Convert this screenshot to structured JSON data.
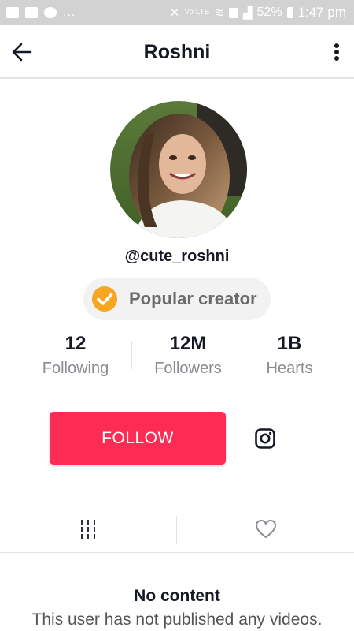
{
  "status_bar": {
    "battery": "52%",
    "time": "1:47 pm",
    "network": "Vo LTE",
    "dots": "...",
    "icons": [
      "image-icon",
      "folder-icon",
      "chat-icon",
      "mute-icon",
      "wifi-icon",
      "sim-icon",
      "signal-icon",
      "battery-icon"
    ]
  },
  "header": {
    "title": "Roshni",
    "back_icon": "arrow-left-icon",
    "more_icon": "vertical-dots-icon"
  },
  "profile": {
    "username": "@cute_roshni",
    "badge": "Popular creator",
    "badge_color": "#f5a623"
  },
  "stats": [
    {
      "value": "12",
      "label": "Following"
    },
    {
      "value": "12M",
      "label": "Followers"
    },
    {
      "value": "1B",
      "label": "Hearts"
    }
  ],
  "actions": {
    "follow_label": "FOLLOW",
    "follow_color": "#fe2c55",
    "instagram_icon": "instagram-icon"
  },
  "tabs": [
    {
      "icon": "videos-grid-icon",
      "active": true
    },
    {
      "icon": "heart-icon",
      "active": false
    }
  ],
  "empty_state": {
    "title": "No content",
    "subtitle": "This user has not published any videos."
  }
}
